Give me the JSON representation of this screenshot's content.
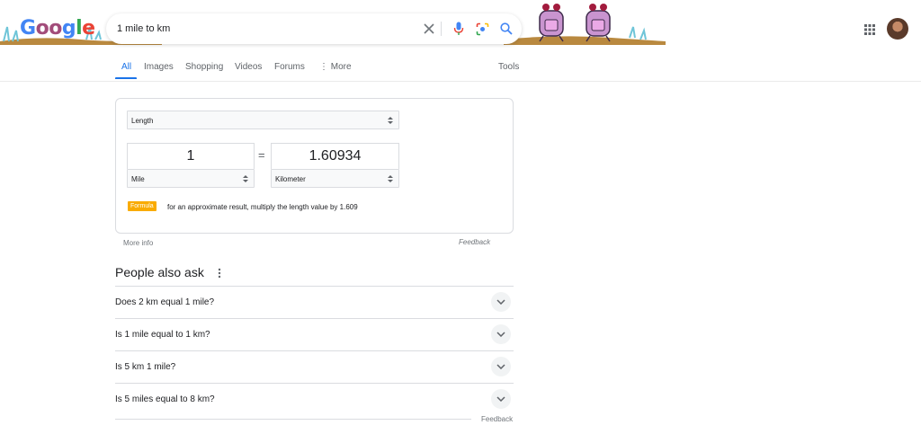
{
  "header": {
    "logo_letters": [
      "G",
      "o",
      "o",
      "g",
      "l",
      "e"
    ],
    "search": {
      "value": "1 mile to km"
    }
  },
  "tabs": [
    {
      "label": "All"
    },
    {
      "label": "Images"
    },
    {
      "label": "Shopping"
    },
    {
      "label": "Videos"
    },
    {
      "label": "Forums"
    },
    {
      "label": "More"
    },
    {
      "label": "Tools"
    }
  ],
  "converter": {
    "category": "Length",
    "from_value": "1",
    "to_value": "1.60934",
    "equals": "=",
    "from_unit": "Mile",
    "to_unit": "Kilometer",
    "formula_label": "Formula",
    "formula_text": "for an approximate result, multiply the length value by 1.609",
    "more_info": "More info",
    "feedback": "Feedback"
  },
  "people_also_ask": {
    "heading": "People also ask",
    "questions": [
      "Does 2 km equal 1 mile?",
      "Is 1 mile equal to 1 km?",
      "Is 5 km 1 mile?",
      "Is 5 miles equal to 8 km?"
    ],
    "feedback": "Feedback"
  },
  "colors": {
    "accent": "#1a73e8",
    "formula_tag": "#f9ab00",
    "border": "#dadce0"
  },
  "icons": [
    "clear-icon",
    "mic-icon",
    "lens-icon",
    "search-icon",
    "apps-icon",
    "avatar",
    "chevron-down-icon",
    "more-vert-icon"
  ]
}
